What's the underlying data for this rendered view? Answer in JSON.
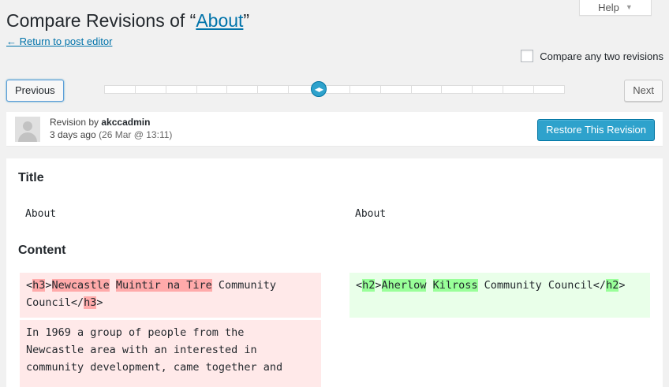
{
  "help_tab": {
    "label": "Help"
  },
  "header": {
    "title_prefix": "Compare Revisions of “",
    "title_link": "About",
    "title_suffix": "”",
    "return_link": "← Return to post editor"
  },
  "compare_any": {
    "label": "Compare any two revisions",
    "checked": false
  },
  "nav": {
    "previous": "Previous",
    "next": "Next"
  },
  "slider": {
    "ticks": 15,
    "handle_position_fraction": 0.47
  },
  "revision": {
    "prefix": "Revision by ",
    "author": "akccadmin",
    "ago": "3 days ago",
    "exact": "(26 Mar @ 13:11)",
    "restore_label": "Restore This Revision"
  },
  "diff": {
    "title_heading": "Title",
    "title_left": "About",
    "title_right": "About",
    "content_heading": "Content",
    "left_block1": {
      "t1": "<",
      "w1": "h3",
      "t2": ">",
      "w2": "Newcastle",
      "t3": " ",
      "w3": "Muintir na Tire",
      "t4": " Community",
      "t5": "Council</",
      "w4": "h3",
      "t6": ">"
    },
    "right_block1": {
      "t1": "<",
      "w1": "h2",
      "t2": ">",
      "w2": "Aherlow",
      "t3": " ",
      "w3": "Kilross",
      "t4": " Community Council</",
      "w4": "h2",
      "t5": ">"
    },
    "left_block2": {
      "line1": "In 1969 a group of people from the",
      "line2": "Newcastle area with an interested in",
      "line3": "community development, came together and"
    }
  },
  "colors": {
    "accent": "#0073aa",
    "primary_button": "#2ea2cc",
    "deleted_bg": "#ffe9e9",
    "deleted_word": "#ffaaaa",
    "inserted_bg": "#e9ffe9",
    "inserted_word": "#99ff99"
  }
}
